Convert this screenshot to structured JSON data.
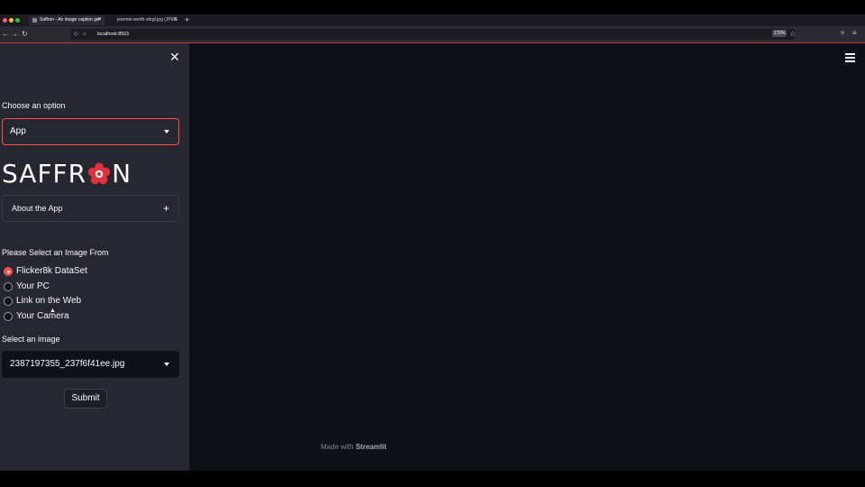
{
  "browser": {
    "tabs": [
      {
        "label": "Saffron - An image caption ge",
        "active": true
      },
      {
        "label": "jeremie-worth-shrgl.jpg (JPEG",
        "active": false
      }
    ],
    "url": "localhost:8501",
    "zoom": "170%"
  },
  "sidebar": {
    "choose_label": "Choose an option",
    "option_value": "App",
    "logo": {
      "left": "SAFFR",
      "right": "N",
      "flower_color": "#e0313c"
    },
    "about_label": "About the App",
    "source_label": "Please Select an Image From",
    "sources": [
      "Flicker8k DataSet",
      "Your PC",
      "Link on the Web",
      "Your Camera"
    ],
    "selected_source_index": 0,
    "image_label": "Select an image",
    "image_value": "2387197355_237f6f41ee.jpg",
    "submit_label": "Submit"
  },
  "footer": {
    "prefix": "Made with",
    "brand": "Streamlit"
  },
  "colors": {
    "accent": "#ff4b4b",
    "sidebar_bg": "#262730",
    "main_bg": "#0e1117"
  },
  "icons": [
    "close-icon",
    "hamburger-menu-icon",
    "chevron-down-icon",
    "plus-icon"
  ]
}
